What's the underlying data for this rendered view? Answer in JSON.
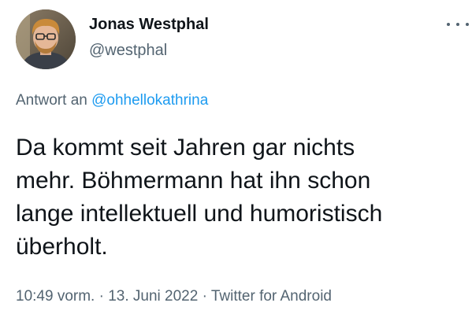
{
  "author": {
    "name": "Jonas Westphal",
    "handle": "@westphal",
    "avatar_icon": "profile-photo-avatar"
  },
  "more_icon": "more-horizontal-icon",
  "reply": {
    "prefix": "Antwort an",
    "mention": "@ohhellokathrina"
  },
  "tweet": {
    "lines": [
      "Da kommt seit Jahren gar nichts",
      "mehr. Böhmermann hat ihn schon",
      "lange intellektuell und humoristisch",
      "überholt."
    ]
  },
  "meta": {
    "time": "10:49 vorm.",
    "separator1": "·",
    "date": "13. Juni 2022",
    "separator2": "·",
    "source": "Twitter for Android"
  },
  "colors": {
    "text": "#0f1419",
    "secondary": "#536471",
    "link": "#1d9bf0"
  }
}
